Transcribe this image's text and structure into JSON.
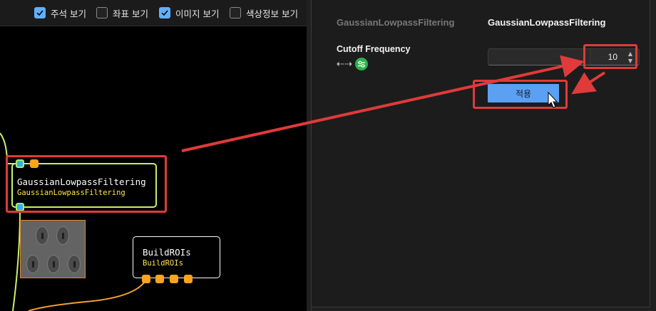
{
  "toolbar": {
    "items": [
      {
        "label": "주석 보기",
        "checked": true
      },
      {
        "label": "좌표 보기",
        "checked": false
      },
      {
        "label": "이미지 보기",
        "checked": true
      },
      {
        "label": "색상정보 보기",
        "checked": false
      }
    ]
  },
  "nodes": {
    "gaussian": {
      "title": "GaussianLowpassFiltering",
      "subtitle": "GaussianLowpassFiltering"
    },
    "build_rois": {
      "title": "BuildROIs",
      "subtitle": "BuildROIs"
    }
  },
  "panel": {
    "title_left": "GaussianLowpassFiltering",
    "title_right": "GaussianLowpassFiltering",
    "param_label": "Cutoff Frequency",
    "param_value": "10",
    "apply_label": "적용"
  },
  "colors": {
    "accent": "#5ba0f2",
    "annotation": "#e03a3a",
    "node_border_active": "#c9f06a",
    "port_orange": "#ffa31a",
    "subtitle": "#ffe64a"
  },
  "icons": [
    "check-icon",
    "swap-arrows-icon",
    "settings-icon",
    "spin-up-icon",
    "spin-down-icon",
    "mouse-cursor-icon"
  ]
}
